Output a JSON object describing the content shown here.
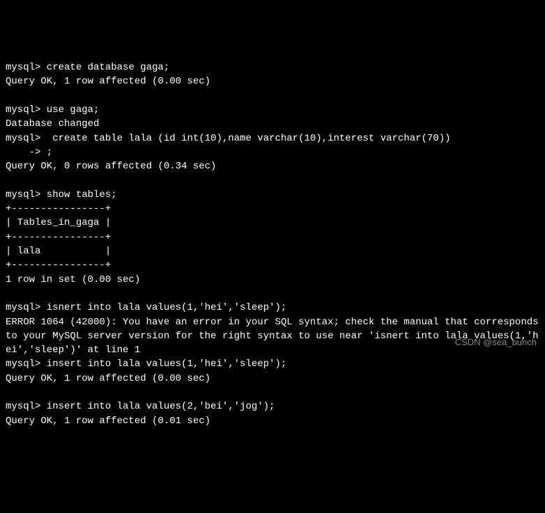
{
  "terminal": {
    "prompt": "mysql>",
    "cont_prompt": "    ->",
    "lines": [
      {
        "t": "cmd",
        "text": "mysql> create database gaga;"
      },
      {
        "t": "out",
        "text": "Query OK, 1 row affected (0.00 sec)"
      },
      {
        "t": "blank"
      },
      {
        "t": "cmd",
        "text": "mysql> use gaga;"
      },
      {
        "t": "out",
        "text": "Database changed"
      },
      {
        "t": "cmd",
        "text": "mysql>  create table lala (id int(10),name varchar(10),interest varchar(70))"
      },
      {
        "t": "cmd",
        "text": "    -> ;"
      },
      {
        "t": "out",
        "text": "Query OK, 0 rows affected (0.34 sec)"
      },
      {
        "t": "blank"
      },
      {
        "t": "cmd",
        "text": "mysql> show tables;"
      },
      {
        "t": "out",
        "text": "+----------------+"
      },
      {
        "t": "out",
        "text": "| Tables_in_gaga |"
      },
      {
        "t": "out",
        "text": "+----------------+"
      },
      {
        "t": "out",
        "text": "| lala           |"
      },
      {
        "t": "out",
        "text": "+----------------+"
      },
      {
        "t": "out",
        "text": "1 row in set (0.00 sec)"
      },
      {
        "t": "blank"
      },
      {
        "t": "cmd",
        "text": "mysql> isnert into lala values(1,'hei','sleep');"
      },
      {
        "t": "out",
        "text": "ERROR 1064 (42000): You have an error in your SQL syntax; check the manual that corresponds to your MySQL server version for the right syntax to use near 'isnert into lala values(1,'hei','sleep')' at line 1"
      },
      {
        "t": "cmd",
        "text": "mysql> insert into lala values(1,'hei','sleep');"
      },
      {
        "t": "out",
        "text": "Query OK, 1 row affected (0.00 sec)"
      },
      {
        "t": "blank"
      },
      {
        "t": "cmd",
        "text": "mysql> insert into lala values(2,'bei','jog');"
      },
      {
        "t": "out",
        "text": "Query OK, 1 row affected (0.01 sec)"
      }
    ]
  },
  "watermark": "CSDN @sea_bunch"
}
